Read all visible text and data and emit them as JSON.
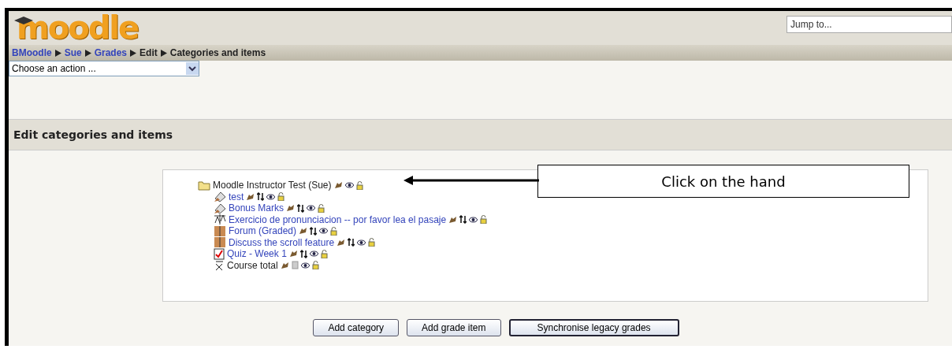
{
  "logo": {
    "text": "moodle"
  },
  "jump": {
    "placeholder": "Jump to..."
  },
  "breadcrumb": [
    {
      "label": "BMoodle",
      "link": true
    },
    {
      "label": "Sue",
      "link": true
    },
    {
      "label": "Grades",
      "link": true
    },
    {
      "label": "Edit",
      "link": false
    },
    {
      "label": "Categories and items",
      "link": false
    }
  ],
  "action_select": {
    "value": "Choose an action ..."
  },
  "heading": "Edit categories and items",
  "tree": {
    "label": "Moodle Instructor Test (Sue)",
    "kind": "category",
    "children": [
      {
        "label": "test",
        "kind": "manual"
      },
      {
        "label": "Bonus Marks",
        "kind": "manual"
      },
      {
        "label": "Exercicio de pronunciacion -- por favor lea el pasaje",
        "kind": "assignment"
      },
      {
        "label": "Forum (Graded)",
        "kind": "forum"
      },
      {
        "label": "Discuss the scroll feature",
        "kind": "forum"
      },
      {
        "label": "Quiz - Week 1",
        "kind": "quiz"
      },
      {
        "label": "Course total",
        "kind": "total"
      }
    ]
  },
  "callout": {
    "text": "Click on the hand"
  },
  "buttons": [
    {
      "label": "Add category",
      "focused": false
    },
    {
      "label": "Add grade item",
      "focused": false
    },
    {
      "label": "Synchronise legacy grades",
      "focused": true
    }
  ]
}
